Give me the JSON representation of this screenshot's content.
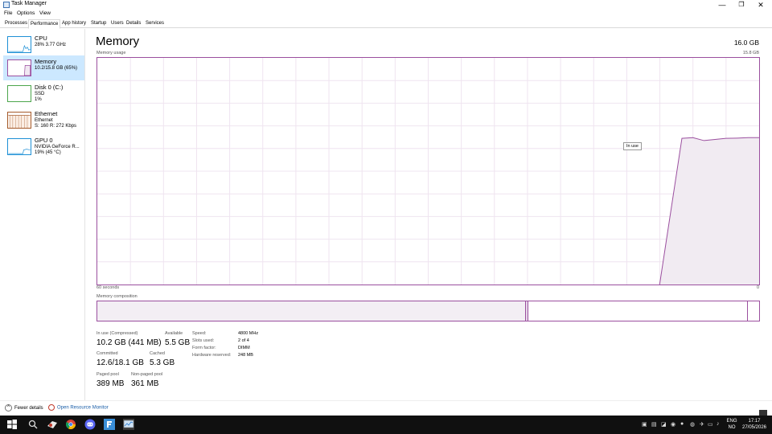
{
  "window": {
    "title": "Task Manager",
    "controls": {
      "minimize": "—",
      "maximize": "❐",
      "close": "✕"
    }
  },
  "menu": [
    "File",
    "Options",
    "View"
  ],
  "tabs": [
    "Processes",
    "Performance",
    "App history",
    "Startup",
    "Users",
    "Details",
    "Services"
  ],
  "active_tab": "Performance",
  "sidebar": {
    "items": [
      {
        "name": "CPU",
        "sub1": "28% 3.77 GHz",
        "sub2": "",
        "color": "#1e90d6"
      },
      {
        "name": "Memory",
        "sub1": "10.2/15.8 GB (65%)",
        "sub2": "",
        "color": "#9b4f9f",
        "active": true
      },
      {
        "name": "Disk 0 (C:)",
        "sub1": "SSD",
        "sub2": "1%",
        "color": "#4ca64c"
      },
      {
        "name": "Ethernet",
        "sub1": "Ethernet",
        "sub2": "S: 160 R: 272 Kbps",
        "color": "#a55a2a"
      },
      {
        "name": "GPU 0",
        "sub1": "NVIDIA GeForce R...",
        "sub2": "19% (45 °C)",
        "color": "#1e90d6"
      }
    ]
  },
  "main": {
    "title": "Memory",
    "total": "16.0 GB",
    "graph_label": "Memory usage",
    "graph_max": "15.8 GB",
    "axis_left": "60 seconds",
    "axis_right": "0",
    "tooltip": "In use",
    "composition_label": "Memory composition",
    "composition": {
      "in_use_fraction": 0.646,
      "modified_fraction": 0.004,
      "standby_end_fraction": 0.98
    },
    "usage_series": [
      0,
      0,
      0,
      0,
      0,
      0,
      0,
      0,
      0,
      0,
      0,
      0,
      0,
      0,
      0,
      0,
      0,
      0,
      0,
      0,
      0,
      0,
      0,
      0,
      0,
      0,
      0,
      0,
      0,
      0,
      0,
      0,
      0,
      0,
      0,
      0,
      0,
      0,
      0,
      0,
      0,
      0,
      0,
      0,
      0,
      0,
      0,
      0,
      0,
      0,
      0,
      0,
      0,
      0.645,
      0.648,
      0.635,
      0.64,
      0.645,
      0.646,
      0.648,
      0.648
    ]
  },
  "stats": {
    "in_use_label": "In use (Compressed)",
    "in_use_value": "10.2 GB (441 MB)",
    "available_label": "Available",
    "available_value": "5.5 GB",
    "committed_label": "Committed",
    "committed_value": "12.6/18.1 GB",
    "cached_label": "Cached",
    "cached_value": "5.3 GB",
    "paged_label": "Paged pool",
    "paged_value": "389 MB",
    "nonpaged_label": "Non-paged pool",
    "nonpaged_value": "361 MB"
  },
  "specs": {
    "speed_label": "Speed:",
    "speed_value": "4800 MHz",
    "slots_label": "Slots used:",
    "slots_value": "2 of 4",
    "form_label": "Form factor:",
    "form_value": "DIMM",
    "reserved_label": "Hardware reserved:",
    "reserved_value": "248 MB"
  },
  "footer": {
    "fewer_details": "Fewer details",
    "open_monitor": "Open Resource Monitor"
  },
  "taskbar": {
    "lang_line1": "ENG",
    "lang_line2": "NO",
    "time": "17:17",
    "date": "27/05/2026",
    "apps": [
      "windows-start",
      "app-generic",
      "chrome",
      "discord",
      "file-explorer",
      "task-manager"
    ]
  }
}
